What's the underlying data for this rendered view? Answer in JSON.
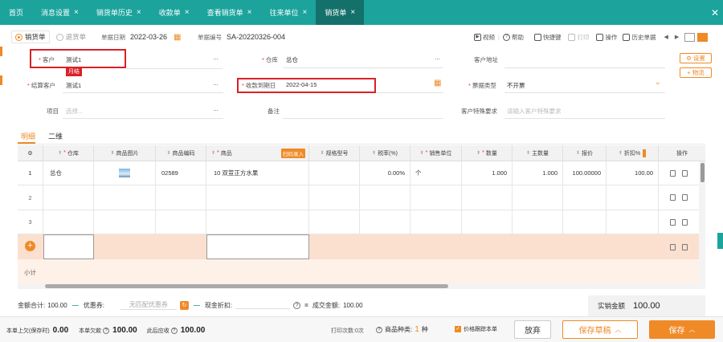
{
  "tabs": [
    {
      "label": "首页",
      "closable": false
    },
    {
      "label": "消息设置",
      "closable": true
    },
    {
      "label": "销货单历史",
      "closable": true
    },
    {
      "label": "收款单",
      "closable": true
    },
    {
      "label": "查看销货单",
      "closable": true
    },
    {
      "label": "往来单位",
      "closable": true
    },
    {
      "label": "销货单",
      "closable": true,
      "active": true
    }
  ],
  "close_all": "✕",
  "header": {
    "type_sales": "销货单",
    "type_return": "退货单",
    "date_label": "单据日期",
    "date_value": "2022-03-26",
    "number_label": "单据编号",
    "number_value": "SA-20220326-004",
    "video": "视频",
    "help": "帮助",
    "shortcut": "快捷键",
    "print": "打印",
    "ops": "操作",
    "history": "历史单据"
  },
  "form": {
    "customer_label": "客户",
    "customer_value": "测试1",
    "customer_badge": "月结",
    "warehouse_label": "仓库",
    "warehouse_value": "总仓",
    "address_label": "客户地址",
    "settle_label": "结算客户",
    "settle_value": "测试1",
    "due_label": "收款到期日",
    "due_value": "2022-04-15",
    "invoice_label": "票据类型",
    "invoice_value": "不开票",
    "project_label": "项目",
    "project_placeholder": "选择...",
    "remark_label": "备注",
    "special_label": "客户特殊要求",
    "special_placeholder": "请输入客户特殊要求",
    "settings_btn": "设置",
    "logistics_btn": "物流"
  },
  "subtabs": {
    "detail": "明细",
    "twodim": "二维"
  },
  "table": {
    "headers": {
      "warehouse": "仓库",
      "image": "商品图片",
      "code": "商品编码",
      "product": "商品",
      "scan": "扫码录入",
      "spec": "规格型号",
      "tax": "税率(%)",
      "unit": "销售单位",
      "qty": "数量",
      "mainqty": "主数量",
      "price": "报价",
      "discount": "折扣%",
      "ops": "操作"
    },
    "rows": [
      {
        "no": "1",
        "warehouse": "总仓",
        "code": "02589",
        "product": "10 双荳正方水果",
        "tax": "0.00%",
        "unit": "个",
        "qty": "1.000",
        "mainqty": "1.000",
        "price": "100.00000",
        "discount": "100.00"
      },
      {
        "no": "2"
      },
      {
        "no": "3"
      }
    ],
    "subtotal": "小计"
  },
  "summary": {
    "amount_label": "金额合计:",
    "amount_value": "100.00",
    "coupon_label": "优惠券:",
    "coupon_value": "无匹配优惠券",
    "cash_label": "现金折扣:",
    "deal_label": "成交金额:",
    "deal_value": "100.00",
    "actual_label": "实销金额",
    "actual_value": "100.00"
  },
  "footer": {
    "owe_prev_label": "本单上欠(保存时)",
    "owe_prev_value": "0.00",
    "owe_label": "本单欠款",
    "owe_value": "100.00",
    "due_label": "此后应收",
    "due_value": "100.00",
    "print_count": "打印次数:0次",
    "kinds_label": "商品种类:",
    "kinds_value": "1",
    "kinds_unit": "种",
    "price_follow": "价格跟踪本单",
    "discard": "放弃",
    "save_draft": "保存草稿",
    "save": "保存"
  },
  "colors": {
    "teal": "#1ba39c",
    "teal_dark": "#14706b",
    "orange": "#ef8a26",
    "red": "#d92127"
  }
}
